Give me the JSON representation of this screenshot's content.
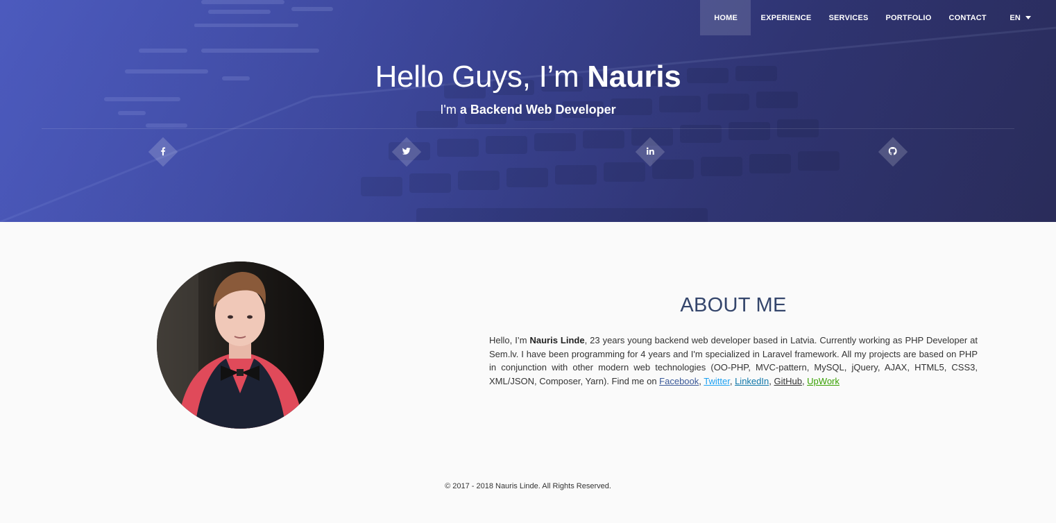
{
  "nav": {
    "items": [
      "HOME",
      "EXPERIENCE",
      "SERVICES",
      "PORTFOLIO",
      "CONTACT"
    ],
    "language": "EN"
  },
  "hero": {
    "greeting": "Hello Guys, I’m ",
    "name": "Nauris",
    "subtitle_prefix": "I'm ",
    "subtitle_role": "a Backend Web Developer"
  },
  "social_icons": [
    {
      "name": "facebook-icon",
      "glyph": "f"
    },
    {
      "name": "twitter-icon",
      "glyph": "t"
    },
    {
      "name": "linkedin-icon",
      "glyph": "in"
    },
    {
      "name": "github-icon",
      "glyph": "gh"
    }
  ],
  "about": {
    "title": "ABOUT ME",
    "intro": "Hello, I’m ",
    "full_name": "Nauris Linde",
    "body": ", 23 years young backend web developer based in Latvia. Currently working as PHP Developer at Sem.lv. I have been programming for 4 years and I'm specialized in Laravel framework. All my projects are based on PHP in conjunction with other modern web technologies (OO-PHP, MVC-pattern, MySQL, jQuery, AJAX, HTML5, CSS3, XML/JSON, Composer, Yarn). Find me on ",
    "links": {
      "facebook": "Facebook",
      "twitter": "Twitter",
      "linkedin": "LinkedIn",
      "github": "GitHub",
      "upwork": "UpWork"
    },
    "separator": ", "
  },
  "footer": {
    "copyright": "© 2017 - 2018 Nauris Linde. All Rights Reserved."
  },
  "colors": {
    "hero_start": "#4a58b8",
    "hero_end": "#2a2d5a",
    "about_title": "#34456b",
    "facebook": "#3b5998",
    "twitter": "#1da1f2",
    "linkedin": "#0e76a8",
    "upwork": "#37a000"
  }
}
